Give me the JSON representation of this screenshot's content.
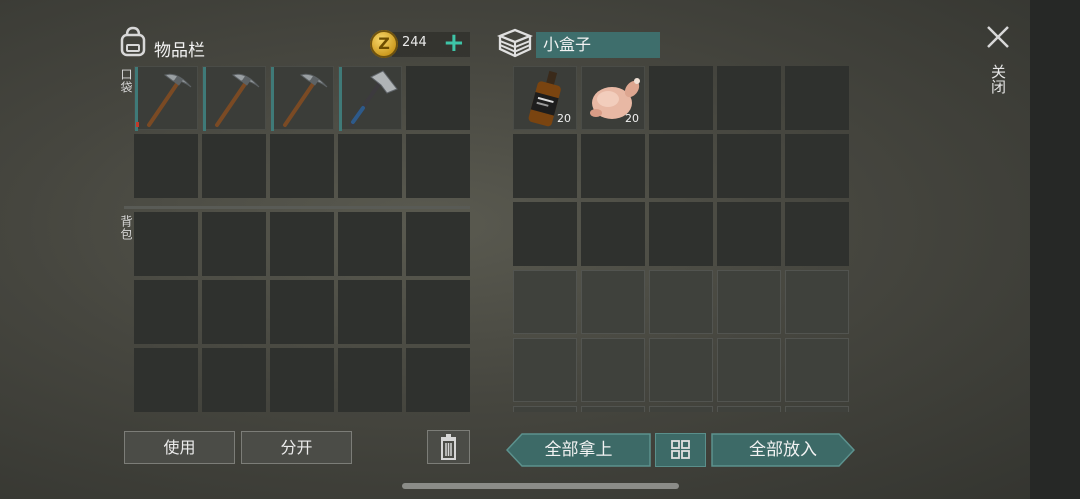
{
  "inventory": {
    "title": "物品栏",
    "coins": "244",
    "coin_symbol": "Z",
    "add_coins_icon": "plus-icon",
    "pocket_label": "口袋",
    "backpack_label": "背包",
    "pocket_items": [
      {
        "name": "pickaxe",
        "icon": "pickaxe-icon"
      },
      {
        "name": "pickaxe",
        "icon": "pickaxe-icon"
      },
      {
        "name": "pickaxe",
        "icon": "pickaxe-icon"
      },
      {
        "name": "hatchet",
        "icon": "hatchet-icon"
      }
    ]
  },
  "container": {
    "title": "小盒子",
    "items": [
      {
        "name": "whiskey-bottle",
        "icon": "bottle-icon",
        "qty": "20"
      },
      {
        "name": "raw-chicken",
        "icon": "chicken-icon",
        "qty": "20"
      }
    ]
  },
  "buttons": {
    "use": "使用",
    "split": "分开",
    "trash_icon": "trash-icon",
    "take_all": "全部拿上",
    "sort_icon": "grid-sort-icon",
    "put_all": "全部放入"
  },
  "close": {
    "icon": "close-icon",
    "label": "关闭"
  },
  "colors": {
    "accent": "#3ec4a7",
    "teal_button": "#3d6a67",
    "durability_low": "#c23a2a"
  }
}
